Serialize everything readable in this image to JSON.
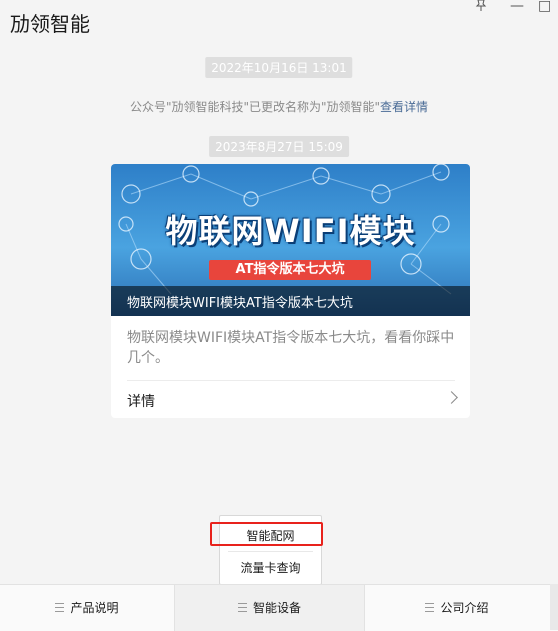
{
  "window": {
    "title": "劢领智能",
    "pin_icon": "pin-icon",
    "minimize_symbol": "—",
    "maximize_symbol": "□"
  },
  "messages": {
    "timestamp_1": "2022年10月16日 13:01",
    "notice_text": "公众号\"劢领智能科技\"已更改名称为\"劢领智能\"",
    "notice_link": "查看详情",
    "timestamp_2": "2023年8月27日 15:09"
  },
  "article_card": {
    "cover_title": "物联网WIFI模块",
    "cover_subtitle": "AT指令版本七大坑",
    "caption": "物联网模块WIFI模块AT指令版本七大坑",
    "description": "物联网模块WIFI模块AT指令版本七大坑，看看你踩中几个。",
    "detail_label": "详情"
  },
  "popup_menu": {
    "items": [
      "智能配网",
      "流量卡查询"
    ],
    "highlight_color": "#e8221c"
  },
  "bottom_menu": {
    "tabs": [
      "产品说明",
      "智能设备",
      "公司介绍"
    ]
  },
  "colors": {
    "link": "#4a6b96",
    "cover_blue": "#2e7fc8",
    "subtitle_red": "#e8453c"
  }
}
